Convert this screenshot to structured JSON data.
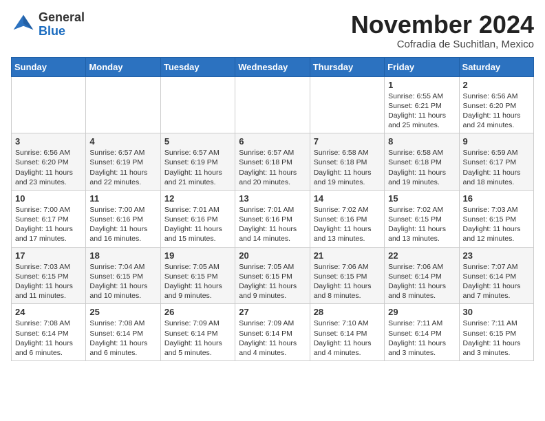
{
  "header": {
    "logo_general": "General",
    "logo_blue": "Blue",
    "month_title": "November 2024",
    "subtitle": "Cofradia de Suchitlan, Mexico"
  },
  "weekdays": [
    "Sunday",
    "Monday",
    "Tuesday",
    "Wednesday",
    "Thursday",
    "Friday",
    "Saturday"
  ],
  "weeks": [
    [
      {
        "day": "",
        "info": ""
      },
      {
        "day": "",
        "info": ""
      },
      {
        "day": "",
        "info": ""
      },
      {
        "day": "",
        "info": ""
      },
      {
        "day": "",
        "info": ""
      },
      {
        "day": "1",
        "info": "Sunrise: 6:55 AM\nSunset: 6:21 PM\nDaylight: 11 hours\nand 25 minutes."
      },
      {
        "day": "2",
        "info": "Sunrise: 6:56 AM\nSunset: 6:20 PM\nDaylight: 11 hours\nand 24 minutes."
      }
    ],
    [
      {
        "day": "3",
        "info": "Sunrise: 6:56 AM\nSunset: 6:20 PM\nDaylight: 11 hours\nand 23 minutes."
      },
      {
        "day": "4",
        "info": "Sunrise: 6:57 AM\nSunset: 6:19 PM\nDaylight: 11 hours\nand 22 minutes."
      },
      {
        "day": "5",
        "info": "Sunrise: 6:57 AM\nSunset: 6:19 PM\nDaylight: 11 hours\nand 21 minutes."
      },
      {
        "day": "6",
        "info": "Sunrise: 6:57 AM\nSunset: 6:18 PM\nDaylight: 11 hours\nand 20 minutes."
      },
      {
        "day": "7",
        "info": "Sunrise: 6:58 AM\nSunset: 6:18 PM\nDaylight: 11 hours\nand 19 minutes."
      },
      {
        "day": "8",
        "info": "Sunrise: 6:58 AM\nSunset: 6:18 PM\nDaylight: 11 hours\nand 19 minutes."
      },
      {
        "day": "9",
        "info": "Sunrise: 6:59 AM\nSunset: 6:17 PM\nDaylight: 11 hours\nand 18 minutes."
      }
    ],
    [
      {
        "day": "10",
        "info": "Sunrise: 7:00 AM\nSunset: 6:17 PM\nDaylight: 11 hours\nand 17 minutes."
      },
      {
        "day": "11",
        "info": "Sunrise: 7:00 AM\nSunset: 6:16 PM\nDaylight: 11 hours\nand 16 minutes."
      },
      {
        "day": "12",
        "info": "Sunrise: 7:01 AM\nSunset: 6:16 PM\nDaylight: 11 hours\nand 15 minutes."
      },
      {
        "day": "13",
        "info": "Sunrise: 7:01 AM\nSunset: 6:16 PM\nDaylight: 11 hours\nand 14 minutes."
      },
      {
        "day": "14",
        "info": "Sunrise: 7:02 AM\nSunset: 6:16 PM\nDaylight: 11 hours\nand 13 minutes."
      },
      {
        "day": "15",
        "info": "Sunrise: 7:02 AM\nSunset: 6:15 PM\nDaylight: 11 hours\nand 13 minutes."
      },
      {
        "day": "16",
        "info": "Sunrise: 7:03 AM\nSunset: 6:15 PM\nDaylight: 11 hours\nand 12 minutes."
      }
    ],
    [
      {
        "day": "17",
        "info": "Sunrise: 7:03 AM\nSunset: 6:15 PM\nDaylight: 11 hours\nand 11 minutes."
      },
      {
        "day": "18",
        "info": "Sunrise: 7:04 AM\nSunset: 6:15 PM\nDaylight: 11 hours\nand 10 minutes."
      },
      {
        "day": "19",
        "info": "Sunrise: 7:05 AM\nSunset: 6:15 PM\nDaylight: 11 hours\nand 9 minutes."
      },
      {
        "day": "20",
        "info": "Sunrise: 7:05 AM\nSunset: 6:15 PM\nDaylight: 11 hours\nand 9 minutes."
      },
      {
        "day": "21",
        "info": "Sunrise: 7:06 AM\nSunset: 6:15 PM\nDaylight: 11 hours\nand 8 minutes."
      },
      {
        "day": "22",
        "info": "Sunrise: 7:06 AM\nSunset: 6:14 PM\nDaylight: 11 hours\nand 8 minutes."
      },
      {
        "day": "23",
        "info": "Sunrise: 7:07 AM\nSunset: 6:14 PM\nDaylight: 11 hours\nand 7 minutes."
      }
    ],
    [
      {
        "day": "24",
        "info": "Sunrise: 7:08 AM\nSunset: 6:14 PM\nDaylight: 11 hours\nand 6 minutes."
      },
      {
        "day": "25",
        "info": "Sunrise: 7:08 AM\nSunset: 6:14 PM\nDaylight: 11 hours\nand 6 minutes."
      },
      {
        "day": "26",
        "info": "Sunrise: 7:09 AM\nSunset: 6:14 PM\nDaylight: 11 hours\nand 5 minutes."
      },
      {
        "day": "27",
        "info": "Sunrise: 7:09 AM\nSunset: 6:14 PM\nDaylight: 11 hours\nand 4 minutes."
      },
      {
        "day": "28",
        "info": "Sunrise: 7:10 AM\nSunset: 6:14 PM\nDaylight: 11 hours\nand 4 minutes."
      },
      {
        "day": "29",
        "info": "Sunrise: 7:11 AM\nSunset: 6:14 PM\nDaylight: 11 hours\nand 3 minutes."
      },
      {
        "day": "30",
        "info": "Sunrise: 7:11 AM\nSunset: 6:15 PM\nDaylight: 11 hours\nand 3 minutes."
      }
    ]
  ]
}
